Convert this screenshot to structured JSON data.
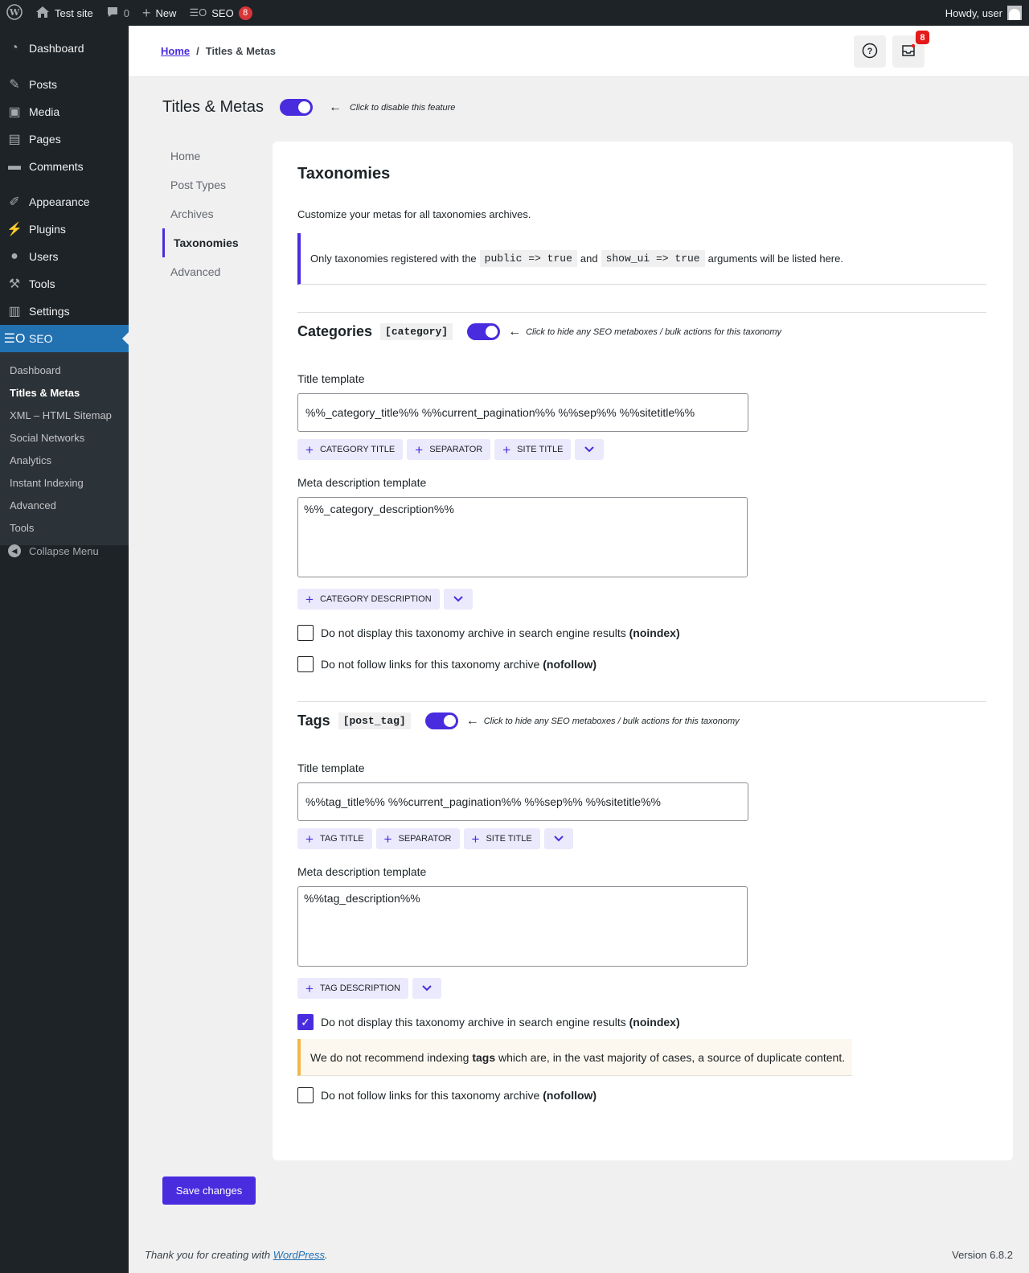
{
  "adminbar": {
    "site_name": "Test site",
    "comments_count": "0",
    "new_label": "New",
    "seo_label": "SEO",
    "seo_badge": "8",
    "greeting": "Howdy, user"
  },
  "sidebar": {
    "items": [
      {
        "label": "Dashboard",
        "icon": "dashboard-icon"
      },
      {
        "label": "Posts",
        "icon": "pin-icon"
      },
      {
        "label": "Media",
        "icon": "media-icon"
      },
      {
        "label": "Pages",
        "icon": "pages-icon"
      },
      {
        "label": "Comments",
        "icon": "comment-icon"
      },
      {
        "label": "Appearance",
        "icon": "brush-icon"
      },
      {
        "label": "Plugins",
        "icon": "plugin-icon"
      },
      {
        "label": "Users",
        "icon": "user-icon"
      },
      {
        "label": "Tools",
        "icon": "wrench-icon"
      },
      {
        "label": "Settings",
        "icon": "settings-icon"
      },
      {
        "label": "SEO",
        "icon": "seo-icon"
      }
    ],
    "submenu": [
      "Dashboard",
      "Titles & Metas",
      "XML – HTML Sitemap",
      "Social Networks",
      "Analytics",
      "Instant Indexing",
      "Advanced",
      "Tools"
    ],
    "collapse_label": "Collapse Menu"
  },
  "header": {
    "breadcrumb_home": "Home",
    "breadcrumb_sep": "/",
    "breadcrumb_current": "Titles & Metas",
    "notification_badge": "8"
  },
  "page": {
    "title": "Titles & Metas",
    "toggle_hint": "Click to disable this feature"
  },
  "tabs": [
    "Home",
    "Post Types",
    "Archives",
    "Taxonomies",
    "Advanced"
  ],
  "main": {
    "title": "Taxonomies",
    "description": "Customize your metas for all taxonomies archives.",
    "notice_before": "Only taxonomies registered with the",
    "notice_code1": "public => true",
    "notice_and": "and",
    "notice_code2": "show_ui => true",
    "notice_after": "arguments will be listed here."
  },
  "taxonomies": [
    {
      "name": "Categories",
      "slug": "[category]",
      "toggle_hint": "Click to hide any SEO metaboxes / bulk actions for this taxonomy",
      "title_label": "Title template",
      "title_value": "%%_category_title%% %%current_pagination%% %%sep%% %%sitetitle%%",
      "title_tags": [
        "Category title",
        "Separator",
        "Site title"
      ],
      "desc_label": "Meta description template",
      "desc_value": "%%_category_description%%",
      "desc_tags": [
        "Category description"
      ],
      "noindex_text": "Do not display this taxonomy archive in search engine results",
      "noindex_bold": "(noindex)",
      "noindex_checked": false,
      "nofollow_text": "Do not follow links for this taxonomy archive",
      "nofollow_bold": "(nofollow)",
      "nofollow_checked": false
    },
    {
      "name": "Tags",
      "slug": "[post_tag]",
      "toggle_hint": "Click to hide any SEO metaboxes / bulk actions for this taxonomy",
      "title_label": "Title template",
      "title_value": "%%tag_title%% %%current_pagination%% %%sep%% %%sitetitle%%",
      "title_tags": [
        "Tag title",
        "Separator",
        "Site title"
      ],
      "desc_label": "Meta description template",
      "desc_value": "%%tag_description%%",
      "desc_tags": [
        "Tag description"
      ],
      "noindex_text": "Do not display this taxonomy archive in search engine results",
      "noindex_bold": "(noindex)",
      "noindex_checked": true,
      "warning_before": "We do not recommend indexing",
      "warning_bold": "tags",
      "warning_after": "which are, in the vast majority of cases, a source of duplicate content.",
      "nofollow_text": "Do not follow links for this taxonomy archive",
      "nofollow_bold": "(nofollow)",
      "nofollow_checked": false
    }
  ],
  "save_label": "Save changes",
  "footer": {
    "thanks_before": "Thank you for creating with",
    "thanks_link": "WordPress",
    "thanks_after": ".",
    "version": "Version 6.8.2"
  },
  "colors": {
    "accent": "#4a2cdf",
    "adminbar_bg": "#1d2327",
    "menu_current": "#2271b1",
    "badge_red": "#d63638"
  }
}
